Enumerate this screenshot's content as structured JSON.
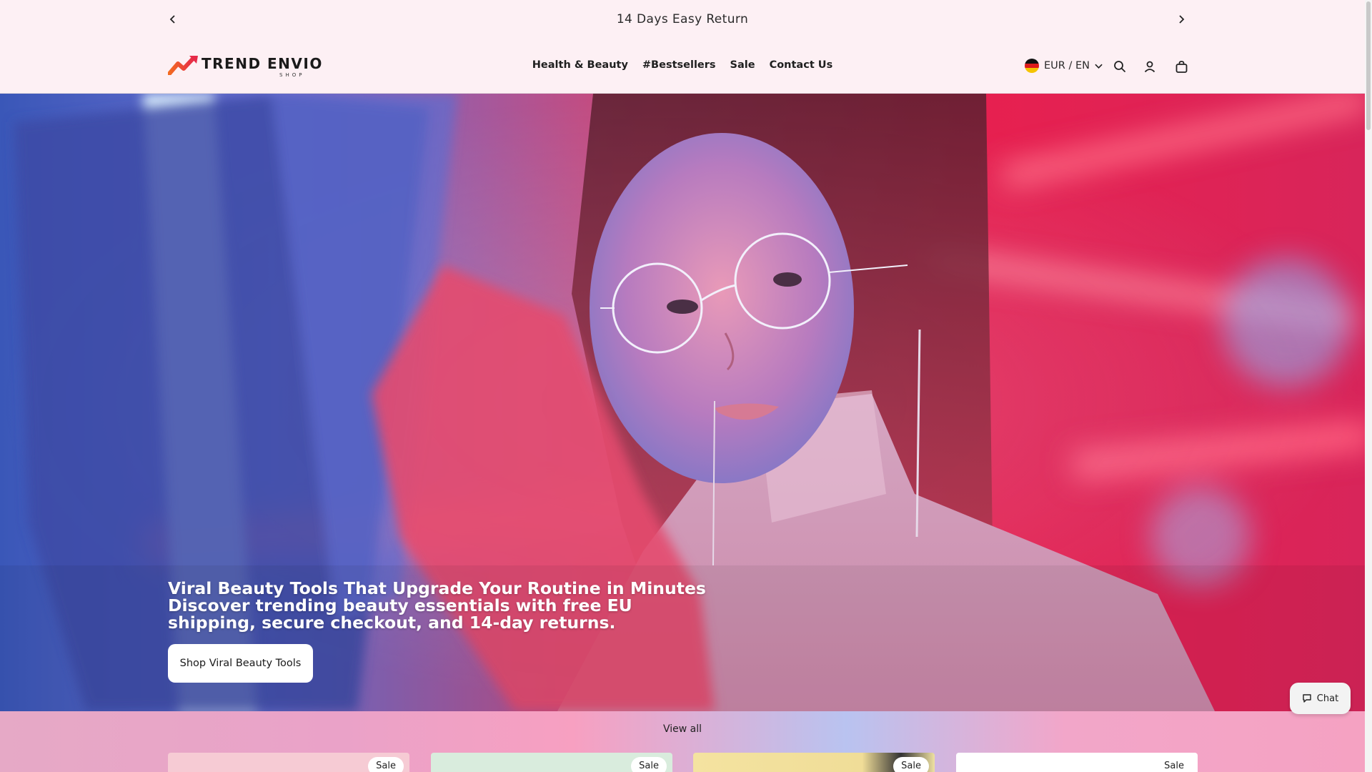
{
  "announcement": {
    "text": "14 Days Easy Return",
    "prev_icon": "chevron-left-icon",
    "next_icon": "chevron-right-icon"
  },
  "header": {
    "logo": {
      "text": "TREND ENVIO",
      "subtext": "SHOP"
    },
    "nav": [
      {
        "label": "Health & Beauty"
      },
      {
        "label": "#Bestsellers"
      },
      {
        "label": "Sale"
      },
      {
        "label": "Contact Us"
      }
    ],
    "locale": {
      "label": "EUR / EN",
      "flag": "germany-flag-icon"
    },
    "icons": [
      "search-icon",
      "account-icon",
      "cart-icon"
    ]
  },
  "hero": {
    "heading_line1": "Viral Beauty Tools That Upgrade Your Routine in Minutes",
    "heading_line2": "Discover trending beauty essentials with free EU shipping, secure checkout, and 14-day returns.",
    "cta_label": "Shop Viral Beauty Tools"
  },
  "collection": {
    "view_all_label": "View all",
    "cards": [
      {
        "badge": "Sale"
      },
      {
        "badge": "Sale"
      },
      {
        "badge": "Sale"
      },
      {
        "badge": "Sale"
      }
    ]
  },
  "chat": {
    "label": "Chat",
    "icon": "chat-bubble-icon"
  },
  "colors": {
    "header_bg": "#fdf0f4",
    "hero_pink": "#e8204f",
    "hero_blue": "#5a8fe0",
    "button_bg": "#ffffff"
  }
}
